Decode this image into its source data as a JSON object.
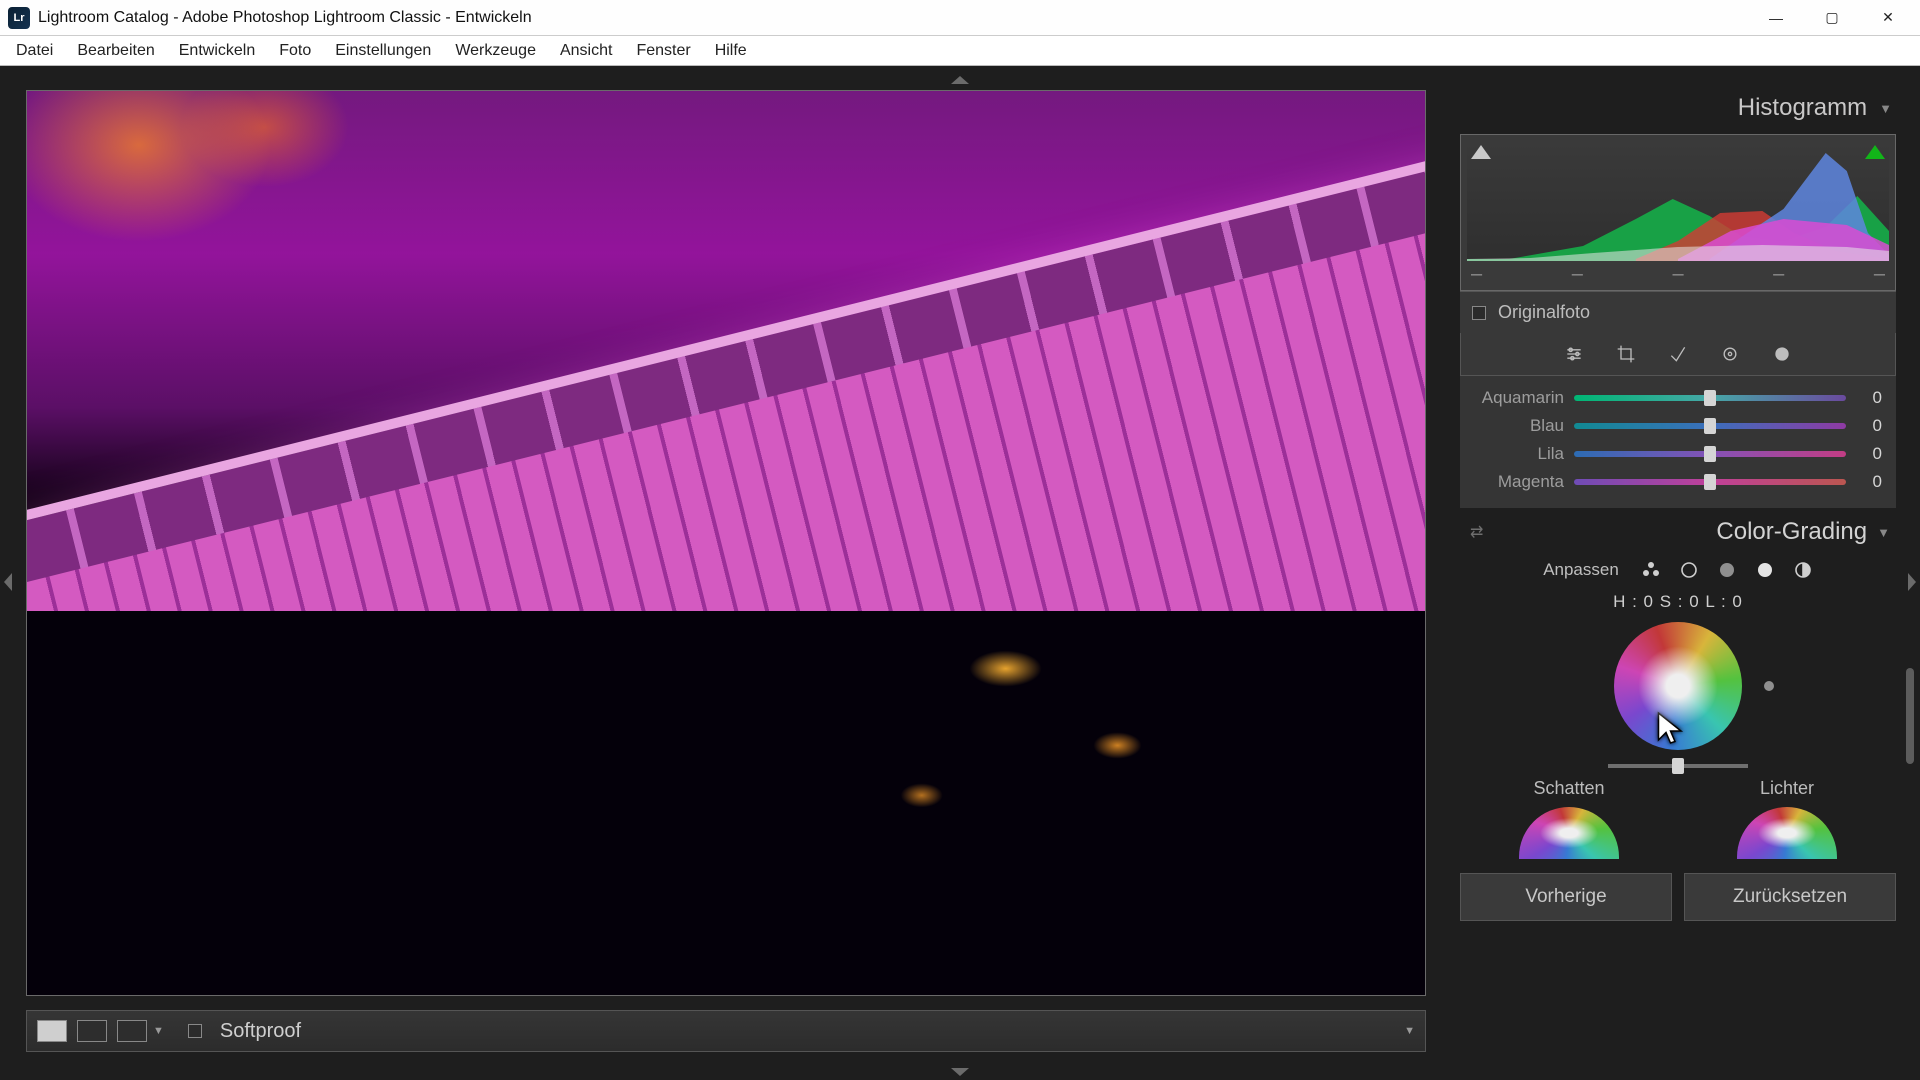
{
  "titlebar": {
    "app_icon_label": "Lr",
    "title": "Lightroom Catalog - Adobe Photoshop Lightroom Classic - Entwickeln"
  },
  "menu": {
    "items": [
      "Datei",
      "Bearbeiten",
      "Entwickeln",
      "Foto",
      "Einstellungen",
      "Werkzeuge",
      "Ansicht",
      "Fenster",
      "Hilfe"
    ]
  },
  "panel": {
    "histogram_title": "Histogramm",
    "original_label": "Originalfoto",
    "sliders": [
      {
        "name": "Aquamarin",
        "value": "0"
      },
      {
        "name": "Blau",
        "value": "0"
      },
      {
        "name": "Lila",
        "value": "0"
      },
      {
        "name": "Magenta",
        "value": "0"
      }
    ],
    "color_grading_title": "Color-Grading",
    "adjust_label": "Anpassen",
    "hsl_readout": "H : 0 S : 0 L : 0",
    "mini": {
      "shadows": "Schatten",
      "highlights": "Lichter"
    },
    "buttons": {
      "prev": "Vorherige",
      "reset": "Zurücksetzen"
    }
  },
  "bottombar": {
    "softproof": "Softproof"
  },
  "ticks": [
    "–",
    "–",
    "–",
    "–",
    "–"
  ]
}
